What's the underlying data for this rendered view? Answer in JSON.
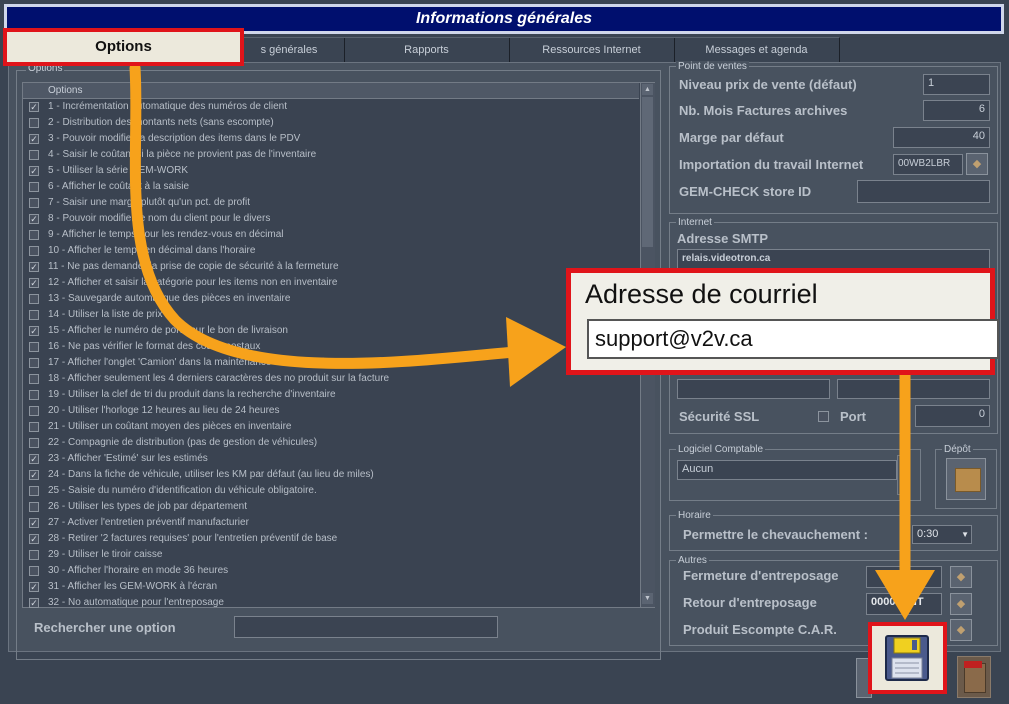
{
  "window": {
    "title": "Informations générales"
  },
  "tabs": [
    {
      "label": "Options",
      "active": true
    },
    {
      "label": "s générales"
    },
    {
      "label": "Rapports"
    },
    {
      "label": "Ressources Internet"
    },
    {
      "label": "Messages et agenda"
    }
  ],
  "options_group": {
    "title": "Options",
    "column_header": "Options",
    "items": [
      {
        "label": "1 - Incrémentation automatique des numéros de client",
        "checked": true
      },
      {
        "label": "2 - Distribution des montants nets (sans escompte)",
        "checked": false
      },
      {
        "label": "3 - Pouvoir modifier la description des items dans le PDV",
        "checked": true
      },
      {
        "label": "4 - Saisir le coûtant si la pièce ne provient pas de l'inventaire",
        "checked": false
      },
      {
        "label": "5 - Utiliser la série GEM-WORK",
        "checked": true
      },
      {
        "label": "6 - Afficher le coûtant à la saisie",
        "checked": false
      },
      {
        "label": "7 - Saisir une marge plutôt qu'un pct. de profit",
        "checked": false
      },
      {
        "label": "8 - Pouvoir modifier le nom du client pour le divers",
        "checked": true
      },
      {
        "label": "9 - Afficher le temps pour les rendez-vous en décimal",
        "checked": false
      },
      {
        "label": "10 - Afficher le temps en décimal dans l'horaire",
        "checked": false
      },
      {
        "label": "11 - Ne pas demander la prise de copie de sécurité à la fermeture",
        "checked": true
      },
      {
        "label": "12 - Afficher et saisir la catégorie pour les items non en inventaire",
        "checked": true
      },
      {
        "label": "13 - Sauvegarde automatique des pièces en inventaire",
        "checked": false
      },
      {
        "label": "14 - Utiliser la liste de prix",
        "checked": false
      },
      {
        "label": "15 - Afficher le numéro de porte sur le bon de livraison",
        "checked": true
      },
      {
        "label": "16 - Ne pas vérifier le format des codes postaux",
        "checked": false
      },
      {
        "label": "17 - Afficher l'onglet 'Camion' dans la maintenance des véhicules",
        "checked": false
      },
      {
        "label": "18 - Afficher seulement les 4 derniers caractères des no produit sur la facture",
        "checked": false
      },
      {
        "label": "19 - Utiliser la clef de tri du produit dans la recherche d'inventaire",
        "checked": false
      },
      {
        "label": "20 - Utiliser l'horloge 12 heures au lieu de 24 heures",
        "checked": false
      },
      {
        "label": "21 - Utiliser un coûtant moyen des pièces en inventaire",
        "checked": false
      },
      {
        "label": "22 - Compagnie de distribution (pas de gestion de véhicules)",
        "checked": false
      },
      {
        "label": "23 - Afficher 'Estimé' sur les estimés",
        "checked": true
      },
      {
        "label": "24 - Dans la fiche de véhicule, utiliser les KM par défaut (au lieu de miles)",
        "checked": true
      },
      {
        "label": "25 - Saisie du numéro d'identification du véhicule obligatoire.",
        "checked": false
      },
      {
        "label": "26 - Utiliser les types de job par département",
        "checked": false
      },
      {
        "label": "27 - Activer l'entretien préventif manufacturier",
        "checked": true
      },
      {
        "label": "28 - Retirer '2 factures requises' pour l'entretien préventif de base",
        "checked": true
      },
      {
        "label": "29 - Utiliser le tiroir caisse",
        "checked": false
      },
      {
        "label": "30 - Afficher l'horaire en mode 36 heures",
        "checked": false
      },
      {
        "label": "31 - Afficher les GEM-WORK à l'écran",
        "checked": true
      },
      {
        "label": "32 - No automatique pour l'entreposage",
        "checked": true
      }
    ],
    "check_mark": "✓",
    "search_label": "Rechercher une option",
    "search_value": ""
  },
  "point_de_ventes": {
    "title": "Point de ventes",
    "niveau_label": "Niveau prix de vente (défaut)",
    "niveau_value": "1",
    "nb_mois_label": "Nb. Mois Factures archives",
    "nb_mois_value": "6",
    "marge_label": "Marge par défaut",
    "marge_value": "40",
    "import_label": "Importation du travail Internet",
    "import_value": "00WB2LBR",
    "gemcheck_label": "GEM-CHECK store ID",
    "gemcheck_value": ""
  },
  "internet": {
    "title": "Internet",
    "smtp_label": "Adresse SMTP",
    "smtp_value": "relais.videotron.ca",
    "email_label": "Adresse de courriel",
    "email_value": "support@v2v.ca",
    "ssl_label": "Sécurité  SSL",
    "port_label": "Port",
    "port_value": "0"
  },
  "logiciel": {
    "title": "Logiciel Comptable",
    "value": "Aucun",
    "depot_label": "Dépôt"
  },
  "horaire": {
    "title": "Horaire",
    "chevauchement_label": "Permettre le chevauchement :",
    "chevauchement_value": "0:30"
  },
  "autres": {
    "title": "Autres",
    "fermeture_label": "Fermeture d'entreposage",
    "fermeture_value": "",
    "retour_label": "Retour d'entreposage",
    "retour_value": "00000ENT",
    "produit_label": "Produit Escompte C.A.R.",
    "produit_value": ""
  },
  "colors": {
    "highlight": "#e0141a",
    "arrow": "#f7a21b",
    "title_bg": "#000f6e"
  }
}
